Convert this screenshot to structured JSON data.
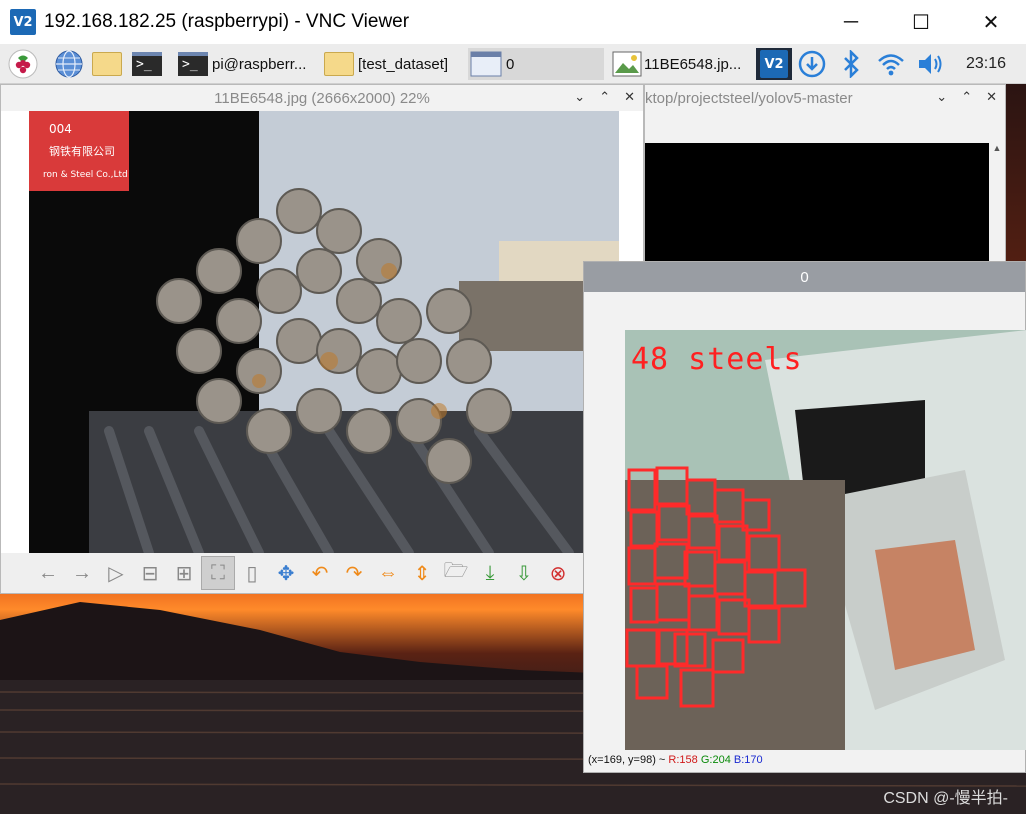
{
  "vnc": {
    "logo": "V2",
    "title": "192.168.182.25 (raspberrypi) - VNC Viewer",
    "controls": {
      "minimize": "─",
      "maximize": "☐",
      "close": "✕"
    }
  },
  "taskbar": {
    "terminal_glyph": ">_",
    "tasks": [
      {
        "label": "pi@raspberr...",
        "icon": "terminal-icon"
      },
      {
        "label": "[test_dataset]",
        "icon": "folder-icon"
      },
      {
        "label": "0",
        "icon": "window-icon"
      },
      {
        "label": "11BE6548.jp...",
        "icon": "image-icon"
      }
    ],
    "tray_vnc": "V2",
    "clock": "23:16"
  },
  "viewer": {
    "title": "11BE6548.jpg (2666x2000) 22%",
    "photo_tag_lines": [
      "004",
      "钢铁有限公司",
      "ron & Steel Co.,Ltd"
    ]
  },
  "terminal": {
    "title": "ktop/projectsteel/yolov5-master"
  },
  "result": {
    "title": "0",
    "detection_label": "48 steels",
    "status": {
      "coords": "(x=169, y=98) ~",
      "r": "R:158",
      "g": "G:204",
      "b": "B:170"
    }
  },
  "watermark": "CSDN @-慢半拍-",
  "colors": {
    "vnc_blue": "#1c69b5",
    "detection_red": "#ff2020",
    "result_title_bg": "#999da3"
  }
}
